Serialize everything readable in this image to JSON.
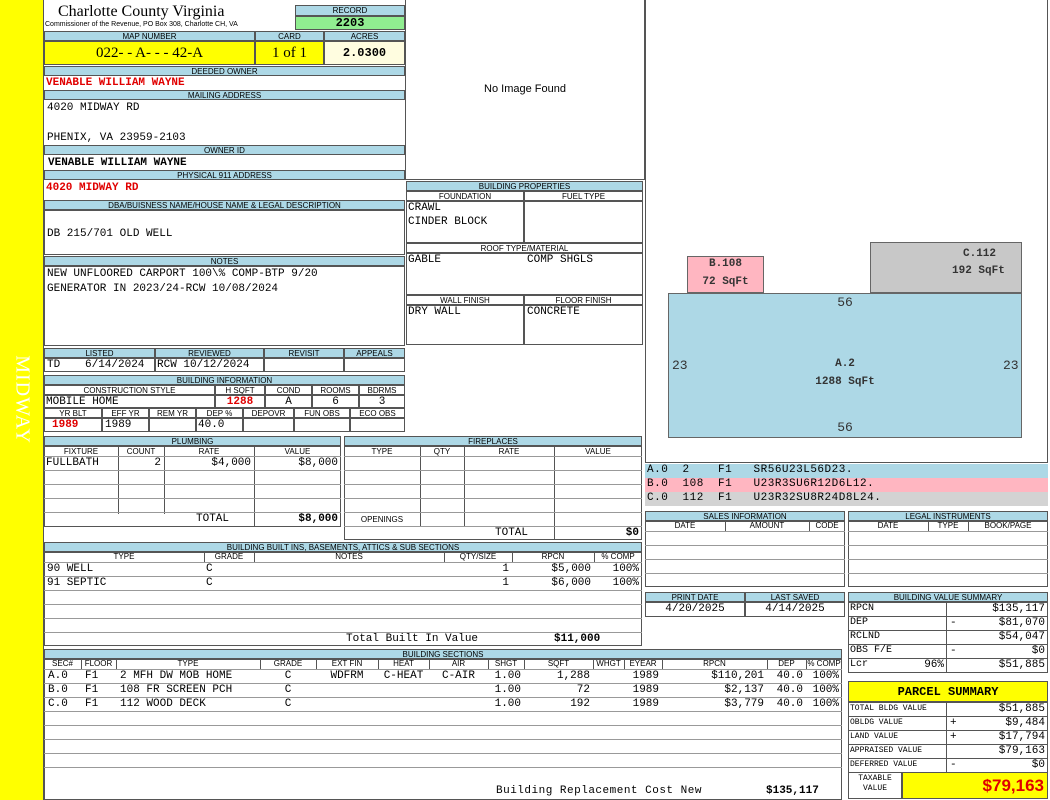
{
  "sidebar": {
    "label": "MIDWAY",
    "color": "#ffff00"
  },
  "header": {
    "county": "Charlotte County Virginia",
    "commissioner": "Commissioner of the Revenue, PO Box 308, Charlotte CH, VA",
    "record_label": "RECORD",
    "record": "2203",
    "map_label": "MAP NUMBER",
    "map": "022- - A- - - 42-A",
    "card_label": "CARD",
    "card": "1 of 1",
    "acres_label": "ACRES",
    "acres": "2.0300"
  },
  "owner": {
    "deeded_label": "DEEDED OWNER",
    "deeded": "VENABLE WILLIAM WAYNE",
    "mailing_label": "MAILING ADDRESS",
    "addr1": "4020 MIDWAY RD",
    "addr2": "PHENIX, VA 23959-2103",
    "ownerid_label": "OWNER ID",
    "ownerid": "VENABLE WILLIAM WAYNE",
    "phys_label": "PHYSICAL 911 ADDRESS",
    "phys": "4020 MIDWAY RD"
  },
  "dba": {
    "label": "DBA/BUISNESS NAME/HOUSE NAME & LEGAL DESCRIPTION",
    "text": "DB 215/701 OLD WELL"
  },
  "notes": {
    "label": "NOTES",
    "line1": "NEW UNFLOORED CARPORT 100\\% COMP-BTP 9/20",
    "line2": "GENERATOR IN 2023/24-RCW 10/08/2024"
  },
  "image": {
    "text": "No Image Found"
  },
  "bldgprops": {
    "label": "BUILDING PROPERTIES",
    "foundation_label": "FOUNDATION",
    "foundation1": "CRAWL",
    "foundation2": "CINDER BLOCK",
    "fuel_label": "FUEL TYPE",
    "roof_label": "ROOF TYPE/MATERIAL",
    "roof1": "GABLE",
    "roof2": "COMP SHGLS",
    "wall_label": "WALL FINISH",
    "wall": "DRY WALL",
    "floor_label": "FLOOR FINISH",
    "floor": "CONCRETE"
  },
  "listed": {
    "listed_label": "LISTED",
    "listed_code": "TD",
    "listed_date": "6/14/2024",
    "reviewed_label": "REVIEWED",
    "reviewed": "RCW 10/12/2024",
    "revisit_label": "REVISIT",
    "appeals_label": "APPEALS"
  },
  "bldginfo": {
    "label": "BUILDING INFORMATION",
    "style_label": "CONSTRUCTION STYLE",
    "style": "MOBILE HOME",
    "hsqft_label": "H SQFT",
    "hsqft": "1288",
    "cond_label": "COND",
    "cond": "A",
    "rooms_label": "ROOMS",
    "rooms": "6",
    "bdrms_label": "BDRMS",
    "bdrms": "3",
    "yrblt_label": "YR BLT",
    "yrblt": "1989",
    "effyr_label": "EFF YR",
    "effyr": "1989",
    "remyr_label": "REM YR",
    "dep_label": "DEP %",
    "dep": "40.0",
    "depovr_label": "DEPOVR",
    "funobs_label": "FUN OBS",
    "ecoobs_label": "ECO OBS"
  },
  "plumbing": {
    "label": "PLUMBING",
    "cols": [
      "FIXTURE",
      "COUNT",
      "RATE",
      "VALUE"
    ],
    "rows": [
      [
        "FULLBATH",
        "2",
        "$4,000",
        "$8,000"
      ]
    ],
    "total_label": "TOTAL",
    "total": "$8,000"
  },
  "fireplaces": {
    "label": "FIREPLACES",
    "cols": [
      "TYPE",
      "QTY",
      "RATE",
      "VALUE"
    ],
    "openings_label": "OPENINGS",
    "total_label": "TOTAL",
    "total": "$0"
  },
  "builtins": {
    "label": "BUILDING BUILT INS, BASEMENTS, ATTICS & SUB SECTIONS",
    "cols": [
      "TYPE",
      "GRADE",
      "NOTES",
      "QTY/SIZE",
      "RPCN",
      "% COMP"
    ],
    "rows": [
      [
        "90 WELL",
        "C",
        "",
        "1",
        "$5,000",
        "100%"
      ],
      [
        "91 SEPTIC",
        "C",
        "",
        "1",
        "$6,000",
        "100%"
      ]
    ],
    "total_label": "Total Built In Value",
    "total": "$11,000"
  },
  "sections": {
    "label": "BUILDING SECTIONS",
    "cols": [
      "SEC#",
      "FLOOR",
      "TYPE",
      "GRADE",
      "EXT FIN",
      "HEAT",
      "AIR",
      "SHGT",
      "SQFT",
      "WHGT",
      "EYEAR",
      "RPCN",
      "DEP",
      "% COMP"
    ],
    "rows": [
      [
        "A.0",
        "F1",
        "2 MFH DW MOB HOME",
        "C",
        "WDFRM",
        "C-HEAT",
        "C-AIR",
        "1.00",
        "1,288",
        "",
        "1989",
        "$110,201",
        "40.0",
        "100%"
      ],
      [
        "B.0",
        "F1",
        "108 FR SCREEN PCH",
        "C",
        "",
        "",
        "",
        "1.00",
        "72",
        "",
        "1989",
        "$2,137",
        "40.0",
        "100%"
      ],
      [
        "C.0",
        "F1",
        "112 WOOD DECK",
        "C",
        "",
        "",
        "",
        "1.00",
        "192",
        "",
        "1989",
        "$3,779",
        "40.0",
        "100%"
      ]
    ],
    "total_label": "Building Replacement Cost New",
    "total": "$135,117"
  },
  "sketch": {
    "a_label": "A.2",
    "a_area": "1288 SqFt",
    "a_top": "56",
    "a_bottom": "56",
    "a_left": "23",
    "a_right": "23",
    "b_label": "B.108",
    "b_area": "72 SqFt",
    "c_label": "C.112",
    "c_area": "192 SqFt",
    "colors": {
      "a": "#add8e6",
      "b": "#ffb6c1",
      "c": "#c8c8c8"
    }
  },
  "sketchcodes": [
    {
      "text": "A.0  2    F1   SR56U23L56D23.",
      "color": "#add8e6"
    },
    {
      "text": "B.0  108  F1   U23R3SU6R12D6L12.",
      "color": "#ffb6c1"
    },
    {
      "text": "C.0  112  F1   U23R32SU8R24D8L24.",
      "color": "#d3d3d3"
    }
  ],
  "sales": {
    "label": "SALES INFORMATION",
    "cols": [
      "DATE",
      "AMOUNT",
      "CODE"
    ]
  },
  "legal": {
    "label": "LEGAL INSTRUMENTS",
    "cols": [
      "DATE",
      "TYPE",
      "BOOK/PAGE"
    ]
  },
  "dates": {
    "print_label": "PRINT DATE",
    "print": "4/20/2025",
    "saved_label": "LAST SAVED",
    "saved": "4/14/2025"
  },
  "valuesummary": {
    "label": "BUILDING VALUE SUMMARY",
    "rows": [
      {
        "k": "RPCN",
        "op": "",
        "pct": "",
        "v": "$135,117"
      },
      {
        "k": "DEP",
        "op": "-",
        "pct": "",
        "v": "$81,070"
      },
      {
        "k": "RCLND",
        "op": "",
        "pct": "",
        "v": "$54,047"
      },
      {
        "k": "OBS F/E",
        "op": "-",
        "pct": "",
        "v": "$0"
      },
      {
        "k": "Lcr",
        "op": "",
        "pct": "96%",
        "v": "$51,885"
      }
    ]
  },
  "parcel": {
    "label": "PARCEL SUMMARY",
    "rows": [
      {
        "k": "TOTAL BLDG VALUE",
        "op": "",
        "v": "$51,885"
      },
      {
        "k": "OBLDG VALUE",
        "op": "+",
        "v": "$9,484"
      },
      {
        "k": "LAND VALUE",
        "op": "+",
        "v": "$17,794"
      },
      {
        "k": "APPRAISED VALUE",
        "op": "",
        "v": "$79,163"
      },
      {
        "k": "DEFERRED VALUE",
        "op": "-",
        "v": "$0"
      }
    ],
    "taxable_label1": "TAXABLE",
    "taxable_label2": "VALUE",
    "taxable": "$79,163"
  }
}
